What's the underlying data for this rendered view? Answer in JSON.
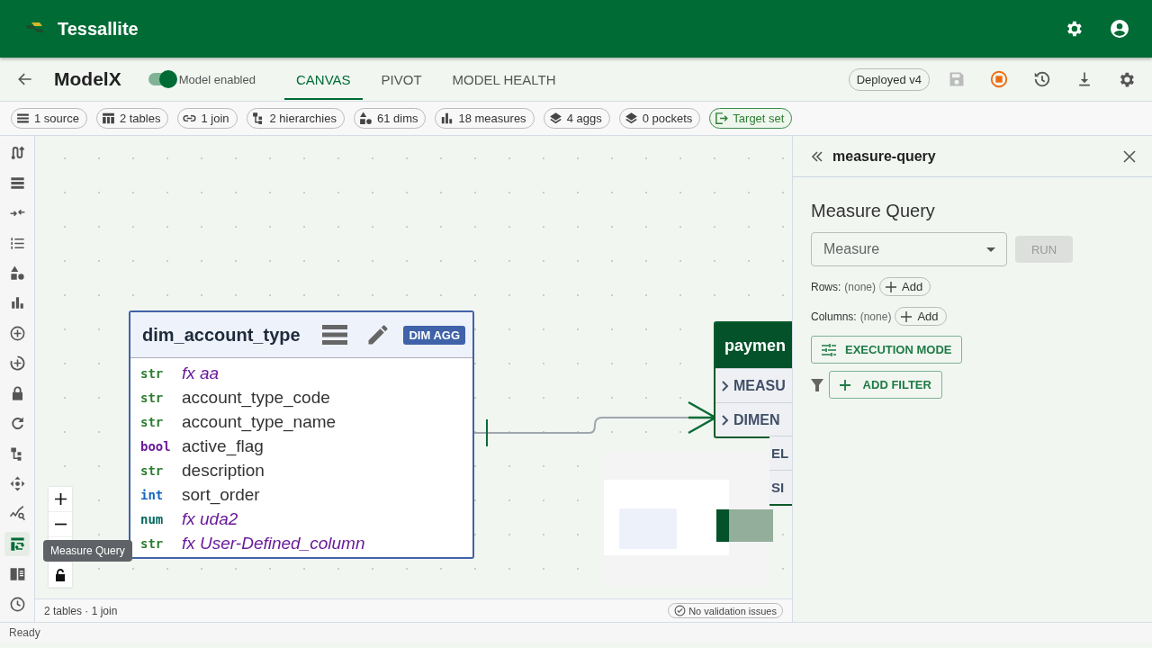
{
  "header": {
    "app_name": "Tessallite"
  },
  "toolbar": {
    "model_name": "ModelX",
    "toggle": {
      "label": "Model enabled",
      "on": true
    },
    "tabs": [
      {
        "label": "CANVAS",
        "selected": true
      },
      {
        "label": "PIVOT",
        "selected": false
      },
      {
        "label": "MODEL HEALTH",
        "selected": false
      }
    ],
    "deploy_badge": "Deployed v4"
  },
  "chips": [
    {
      "kind": "source",
      "label": "1 source"
    },
    {
      "kind": "tables",
      "label": "2 tables"
    },
    {
      "kind": "join",
      "label": "1 join"
    },
    {
      "kind": "hierarchy",
      "label": "2 hierarchies"
    },
    {
      "kind": "dims",
      "label": "61 dims"
    },
    {
      "kind": "measures",
      "label": "18 measures"
    },
    {
      "kind": "layers",
      "label": "4 aggs"
    },
    {
      "kind": "layers",
      "label": "0 pockets"
    },
    {
      "kind": "target",
      "label": "Target set"
    }
  ],
  "sidebar": {
    "items": [
      {
        "kind": "lineage",
        "selected": false
      },
      {
        "kind": "list",
        "selected": false
      },
      {
        "kind": "merge",
        "selected": false
      },
      {
        "kind": "numbered",
        "selected": false
      },
      {
        "kind": "dims",
        "selected": false
      },
      {
        "kind": "measures",
        "selected": false
      },
      {
        "kind": "add",
        "selected": false
      },
      {
        "kind": "add-cycle",
        "selected": false
      },
      {
        "kind": "lock",
        "selected": false
      },
      {
        "kind": "refresh",
        "selected": false
      },
      {
        "kind": "hierarchy",
        "selected": false
      },
      {
        "kind": "move",
        "selected": false
      },
      {
        "kind": "analyze",
        "selected": false
      },
      {
        "kind": "query",
        "selected": true
      },
      {
        "kind": "book",
        "selected": false
      },
      {
        "kind": "clock",
        "selected": false
      }
    ]
  },
  "canvas": {
    "dimension_table": {
      "name": "dim_account_type",
      "badge": "DIM AGG",
      "columns": [
        {
          "type": "str",
          "color": "#2e7d32",
          "name": "fx aa",
          "calculated": true
        },
        {
          "type": "str",
          "color": "#2e7d32",
          "name": "account_type_code",
          "calculated": false
        },
        {
          "type": "str",
          "color": "#2e7d32",
          "name": "account_type_name",
          "calculated": false
        },
        {
          "type": "bool",
          "color": "#6a1b9a",
          "name": "active_flag",
          "calculated": false
        },
        {
          "type": "str",
          "color": "#2e7d32",
          "name": "description",
          "calculated": false
        },
        {
          "type": "int",
          "color": "#1565c0",
          "name": "sort_order",
          "calculated": false
        },
        {
          "type": "num",
          "color": "#00695c",
          "name": "fx uda2",
          "calculated": true
        },
        {
          "type": "str",
          "color": "#2e7d32",
          "name": "fx User-Defined_column",
          "calculated": true
        }
      ]
    },
    "fact_table": {
      "name": "paymen",
      "sections": [
        {
          "label": "MEASU",
          "covered": false
        },
        {
          "label": "DIMEN",
          "covered": false
        },
        {
          "label": "EL",
          "covered": true
        },
        {
          "label": "SI",
          "covered": true
        }
      ]
    },
    "tooltip": "Measure Query",
    "footer": "2 tables · 1 join",
    "validation": "No validation issues"
  },
  "panel": {
    "title": "measure-query",
    "heading": "Measure Query",
    "select_placeholder": "Measure",
    "run": {
      "label": "RUN",
      "disabled": true
    },
    "rows_label": "Rows:",
    "rows_value": "(none)",
    "rows_add": "Add",
    "columns_label": "Columns:",
    "columns_value": "(none)",
    "columns_add": "Add",
    "execution_mode": "EXECUTION MODE",
    "add_filter": "ADD FILTER"
  },
  "status_bar": "Ready"
}
